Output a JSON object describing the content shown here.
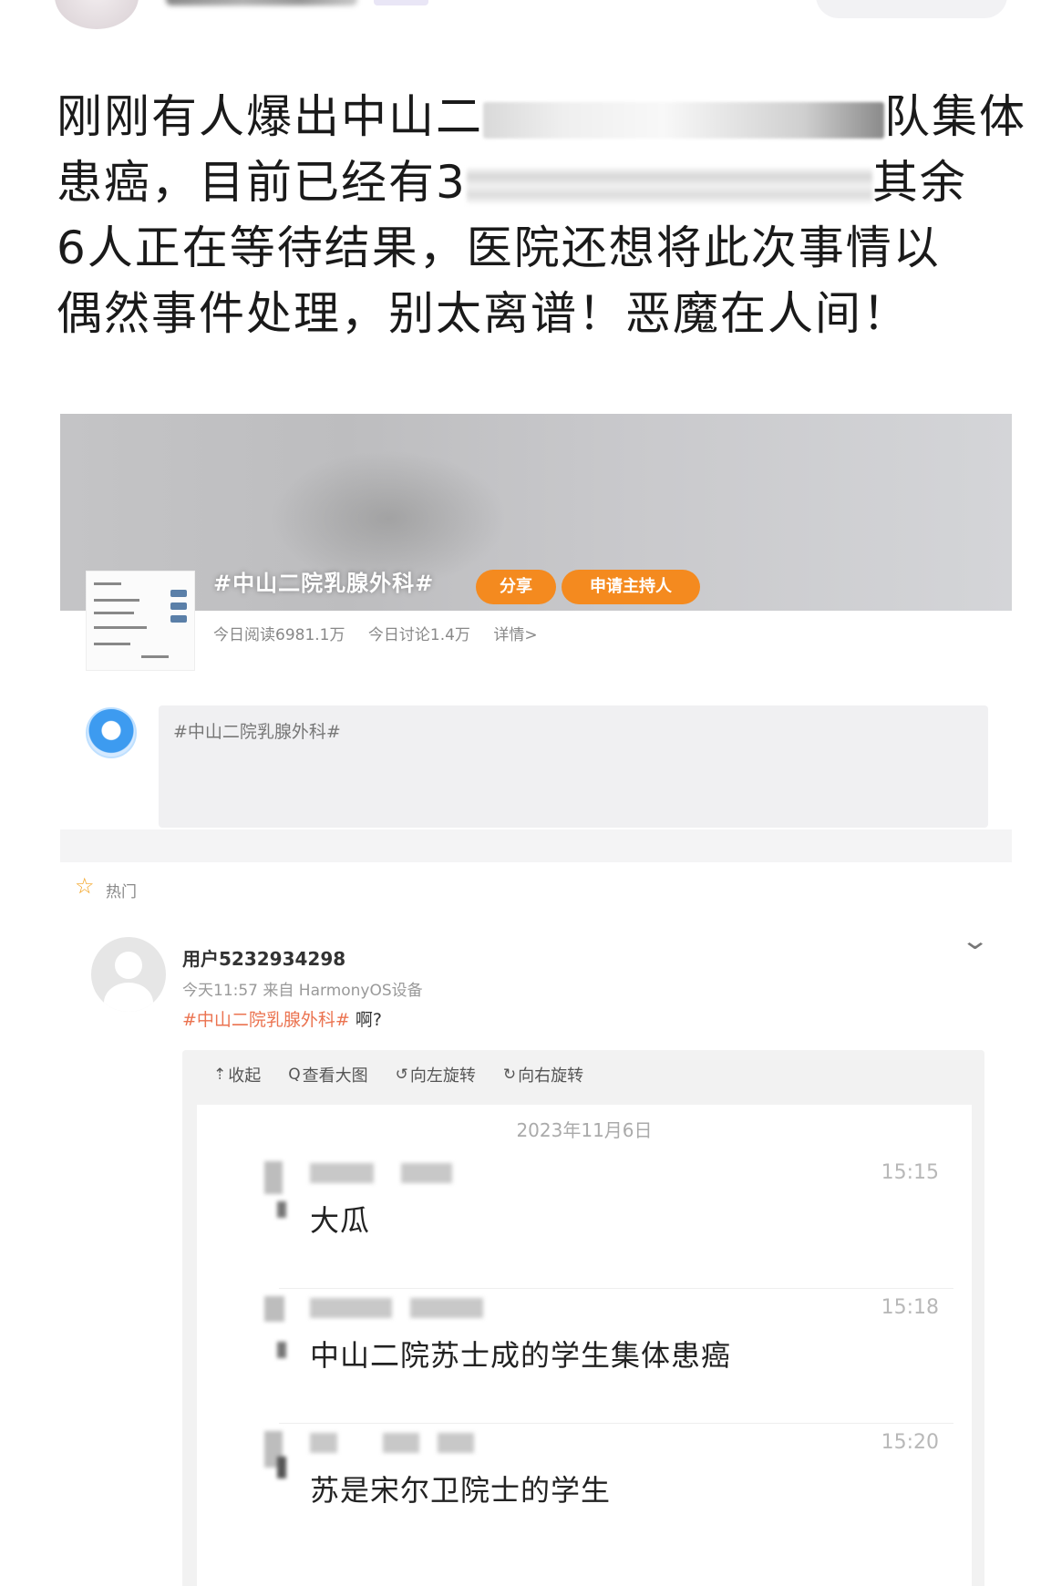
{
  "post": {
    "lines": [
      {
        "before": "刚刚有人爆出中山二",
        "after": "队集体"
      },
      {
        "before": "患癌，目前已经有3",
        "after": "其余"
      },
      {
        "text": "6人正在等待结果，医院还想将此次事情以"
      },
      {
        "text": "偶然事件处理，别太离谱！恶魔在人间！"
      }
    ]
  },
  "topic": {
    "title": "#中山二院乳腺外科#",
    "share_label": "分享",
    "host_label": "申请主持人",
    "reads": "今日阅读6981.1万",
    "discussions": "今日讨论1.4万",
    "details": "详情>"
  },
  "compose": {
    "text": "#中山二院乳腺外科#"
  },
  "hot": {
    "label": "热门"
  },
  "feed_post": {
    "username": "用户5232934298",
    "meta": "今天11:57  来自 HarmonyOS设备",
    "hashtag": "#中山二院乳腺外科#",
    "text": " 啊?"
  },
  "viewer": {
    "collapse": "收起",
    "view_large": "查看大图",
    "rotate_left": "向左旋转",
    "rotate_right": "向右旋转"
  },
  "chat": {
    "date": "2023年11月6日",
    "messages": [
      {
        "time": "15:15",
        "text": "大瓜"
      },
      {
        "time": "15:18",
        "text": "中山二院苏士成的学生集体患癌"
      },
      {
        "time": "15:20",
        "text": "苏是宋尔卫院士的学生"
      }
    ]
  },
  "icons": {
    "star": "star-icon",
    "chevron": "chevron-down-icon",
    "upload": "collapse-icon",
    "search": "search-icon",
    "rotate_left": "rotate-left-icon",
    "rotate_right": "rotate-right-icon"
  },
  "colors": {
    "accent_orange": "#f48a1f",
    "hashtag": "#eb7350",
    "star": "#f3a21f"
  }
}
